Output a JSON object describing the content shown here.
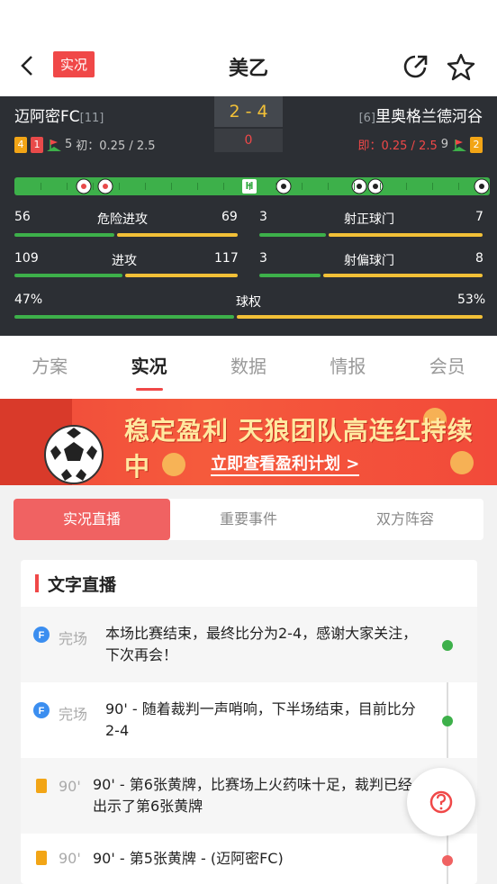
{
  "nav": {
    "badge": "实况",
    "title": "美乙"
  },
  "match": {
    "home": {
      "name": "迈阿密FC",
      "rank": "[11]",
      "yellow": "4",
      "red": "1",
      "corners": "5",
      "odds_label": "初：0.25 / 2.5"
    },
    "away": {
      "name": "里奥格兰德河谷",
      "rank": "[6]",
      "yellow": "2",
      "corners": "9",
      "odds_label": "即：0.25 / 2.5"
    },
    "score": "2 - 4",
    "half_score": "0",
    "half_marker": "H"
  },
  "stats": {
    "dangerous_attack": {
      "label": "危险进攻",
      "home": "56",
      "away": "69",
      "home_frac": 0.448
    },
    "shots_on_target": {
      "label": "射正球门",
      "home": "3",
      "away": "7",
      "home_frac": 0.3
    },
    "attack": {
      "label": "进攻",
      "home": "109",
      "away": "117",
      "home_frac": 0.482
    },
    "shots_off_target": {
      "label": "射偏球门",
      "home": "3",
      "away": "8",
      "home_frac": 0.273
    },
    "possession": {
      "label": "球权",
      "home": "47%",
      "away": "53%",
      "home_frac": 0.47
    }
  },
  "tabs": [
    "方案",
    "实况",
    "数据",
    "情报",
    "会员"
  ],
  "banner": {
    "headline": "稳定盈利 天狼团队高连红持续中",
    "cta": "立即查看盈利计划 >"
  },
  "subtabs": [
    "实况直播",
    "重要事件",
    "双方阵容"
  ],
  "live": {
    "title": "文字直播",
    "entries": [
      {
        "icon": "f-whistle-icon",
        "time": "完场",
        "text": "本场比赛结束，最终比分为2-4，感谢大家关注，下次再会！"
      },
      {
        "icon": "f-whistle-icon",
        "time": "完场",
        "text": "90' - 随着裁判一声哨响，下半场结束，目前比分2-4"
      },
      {
        "icon": "yellow-card-icon",
        "time": "90'",
        "text": "90' - 第6张黄牌，比赛场上火药味十足，裁判已经出示了第6张黄牌"
      },
      {
        "icon": "yellow-card-icon",
        "time": "90'",
        "text": "90' - 第5张黄牌 - (迈阿密FC)"
      }
    ]
  },
  "colors": {
    "accent_red": "#f04848",
    "home_green": "#3db04a",
    "away_yellow": "#f2c037",
    "panel_dark": "#2c2f34"
  }
}
